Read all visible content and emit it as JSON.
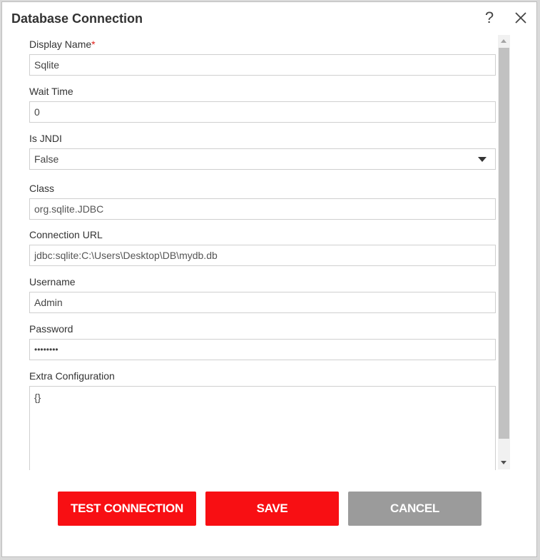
{
  "dialog": {
    "title": "Database Connection",
    "help_glyph": "?"
  },
  "fields": {
    "display_name": {
      "label": "Display Name",
      "required": "*",
      "value": "Sqlite"
    },
    "wait_time": {
      "label": "Wait Time",
      "value": "0"
    },
    "is_jndi": {
      "label": "Is JNDI",
      "value": "False"
    },
    "class": {
      "label": "Class",
      "value": "org.sqlite.JDBC"
    },
    "connection_url": {
      "label": "Connection URL",
      "value": "jdbc:sqlite:C:\\Users\\Desktop\\DB\\mydb.db"
    },
    "username": {
      "label": "Username",
      "value": "Admin"
    },
    "password": {
      "label": "Password",
      "value": "••••••••"
    },
    "extra_configuration": {
      "label": "Extra Configuration",
      "value": "{}"
    }
  },
  "buttons": {
    "test_connection": "TEST CONNECTION",
    "save": "SAVE",
    "cancel": "CANCEL"
  },
  "colors": {
    "primary": "#f80f13",
    "secondary": "#9b9b9b"
  }
}
